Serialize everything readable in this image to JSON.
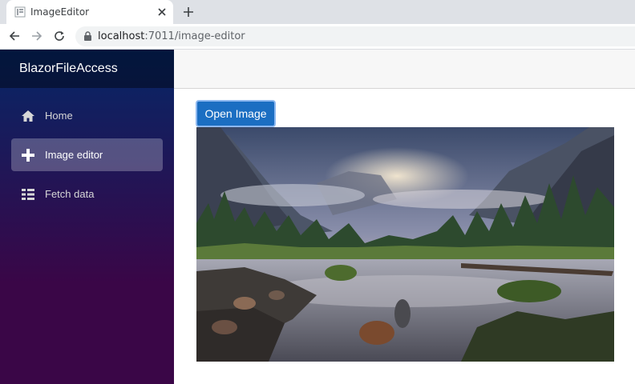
{
  "browser": {
    "tab_title": "ImageEditor",
    "url_host": "localhost",
    "url_path": ":7011/image-editor"
  },
  "sidebar": {
    "brand": "BlazorFileAccess",
    "items": [
      {
        "label": "Home",
        "icon": "home-icon",
        "active": false
      },
      {
        "label": "Image editor",
        "icon": "plus-icon",
        "active": true
      },
      {
        "label": "Fetch data",
        "icon": "list-icon",
        "active": false
      }
    ]
  },
  "main": {
    "open_button_label": "Open Image",
    "image_subject": "mountain river landscape"
  },
  "colors": {
    "sidebar_top": "#052767",
    "sidebar_bottom": "#3a0647",
    "button": "#1b6ec2"
  }
}
